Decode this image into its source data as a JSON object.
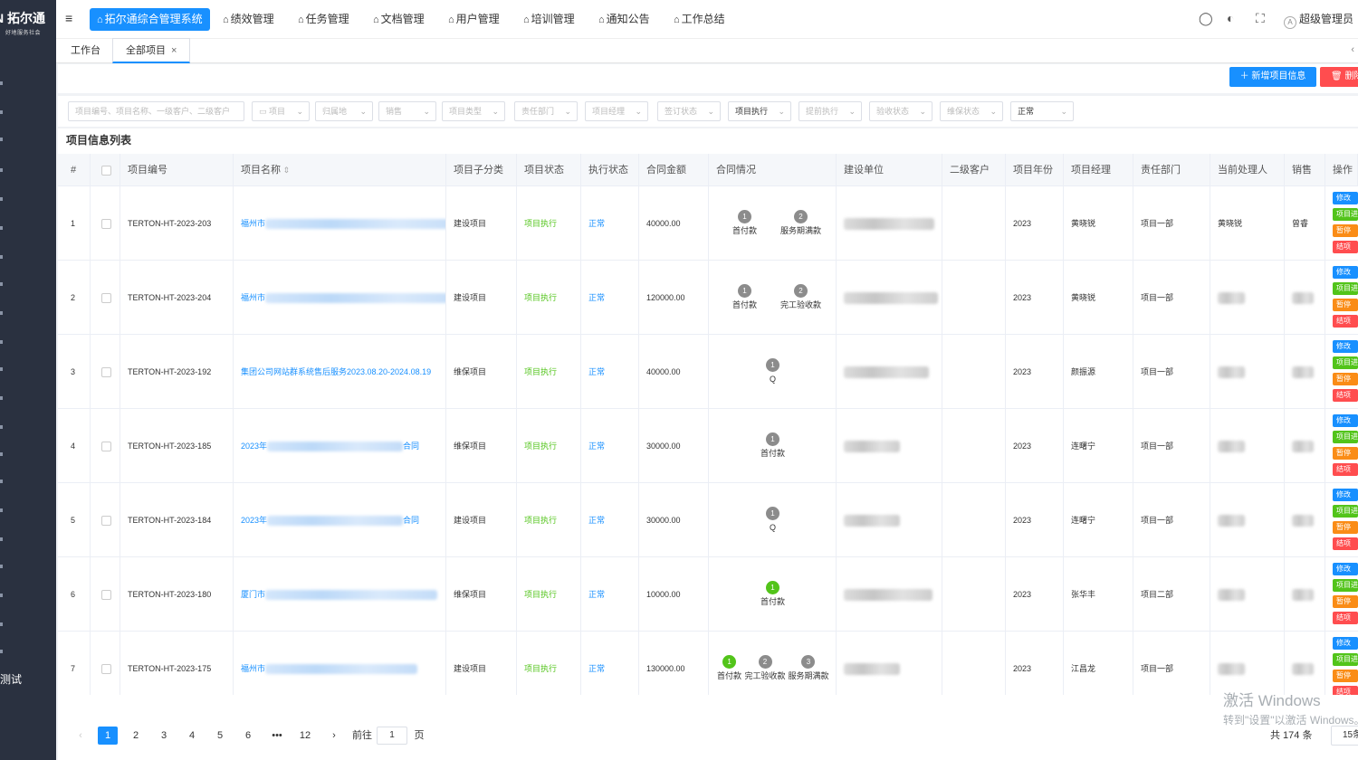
{
  "sidebar": {
    "logo_title": "N 拓尔通",
    "logo_sub": "好地服务社会",
    "bottom_item": "测试"
  },
  "header": {
    "menu_icon": "hamburger-icon",
    "nav": [
      {
        "label": "拓尔通综合管理系统",
        "active": true
      },
      {
        "label": "绩效管理"
      },
      {
        "label": "任务管理"
      },
      {
        "label": "文档管理"
      },
      {
        "label": "用户管理"
      },
      {
        "label": "培训管理"
      },
      {
        "label": "通知公告"
      },
      {
        "label": "工作总结"
      }
    ],
    "nav_icon": "home-icon",
    "icons": [
      "chat-icon",
      "palette-icon",
      "fullscreen-icon"
    ],
    "user": "超级管理员"
  },
  "tabs": [
    {
      "label": "工作台"
    },
    {
      "label": "全部项目",
      "active": true,
      "close": "×"
    }
  ],
  "toolbar": {
    "add_label": "＋ 新增项目信息",
    "delete_label": "删除"
  },
  "filters": [
    {
      "placeholder": "项目编号、项目名称、一级客户、二级客户"
    },
    {
      "placeholder": "项目"
    },
    {
      "placeholder": "归属地"
    },
    {
      "placeholder": "销售"
    },
    {
      "placeholder": "项目类型"
    },
    {
      "placeholder": "责任部门"
    },
    {
      "placeholder": "项目经理"
    },
    {
      "placeholder": "签订状态"
    },
    {
      "value": "项目执行"
    },
    {
      "placeholder": "提前执行"
    },
    {
      "placeholder": "验收状态"
    },
    {
      "placeholder": "维保状态"
    },
    {
      "value": "正常"
    }
  ],
  "list_title": "项目信息列表",
  "columns": [
    "#",
    "",
    "项目编号",
    "项目名称",
    "项目子分类",
    "项目状态",
    "执行状态",
    "合同金额",
    "合同情况",
    "建设单位",
    "二级客户",
    "项目年份",
    "项目经理",
    "责任部门",
    "当前处理人",
    "销售",
    "操作"
  ],
  "sort_icon": "sort-icon",
  "rows": [
    {
      "idx": "1",
      "code": "TERTON-HT-2023-203",
      "name_prefix": "福州市",
      "name_suffix": "",
      "sub": "建设项目",
      "status": "项目执行",
      "exec": "正常",
      "amount": "40000.00",
      "steps": [
        {
          "n": "1",
          "label": "首付款"
        },
        {
          "n": "2",
          "label": "服务期满款"
        }
      ],
      "year": "2023",
      "manager": "黄晓锐",
      "dept": "项目一部",
      "handler": "黄晓锐",
      "sales": "曾睿"
    },
    {
      "idx": "2",
      "code": "TERTON-HT-2023-204",
      "name_prefix": "福州市",
      "name_suffix": "",
      "sub": "建设项目",
      "status": "项目执行",
      "exec": "正常",
      "amount": "120000.00",
      "steps": [
        {
          "n": "1",
          "label": "首付款"
        },
        {
          "n": "2",
          "label": "完工验收款"
        }
      ],
      "year": "2023",
      "manager": "黄晓锐",
      "dept": "项目一部",
      "handler": "",
      "sales": ""
    },
    {
      "idx": "3",
      "code": "TERTON-HT-2023-192",
      "name_prefix": "集团公司网站群系统售后服务2023.08.20-2024.08.19",
      "name_suffix": "",
      "sub": "维保项目",
      "status": "项目执行",
      "exec": "正常",
      "amount": "40000.00",
      "steps": [
        {
          "n": "1",
          "label": "Q"
        }
      ],
      "year": "2023",
      "manager": "颜振源",
      "dept": "项目一部",
      "handler": "",
      "sales": ""
    },
    {
      "idx": "4",
      "code": "TERTON-HT-2023-185",
      "name_prefix": "2023年",
      "name_suffix": "合同",
      "sub": "维保项目",
      "status": "项目执行",
      "exec": "正常",
      "amount": "30000.00",
      "steps": [
        {
          "n": "1",
          "label": "首付款"
        }
      ],
      "year": "2023",
      "manager": "连曙宁",
      "dept": "项目一部",
      "handler": "",
      "sales": ""
    },
    {
      "idx": "5",
      "code": "TERTON-HT-2023-184",
      "name_prefix": "2023年",
      "name_suffix": "合同",
      "sub": "建设项目",
      "status": "项目执行",
      "exec": "正常",
      "amount": "30000.00",
      "steps": [
        {
          "n": "1",
          "label": "Q"
        }
      ],
      "year": "2023",
      "manager": "连曙宁",
      "dept": "项目一部",
      "handler": "",
      "sales": ""
    },
    {
      "idx": "6",
      "code": "TERTON-HT-2023-180",
      "name_prefix": "厦门市",
      "name_suffix": "",
      "sub": "维保项目",
      "status": "项目执行",
      "exec": "正常",
      "amount": "10000.00",
      "steps": [
        {
          "n": "1",
          "label": "首付款",
          "done": true
        }
      ],
      "year": "2023",
      "manager": "张华丰",
      "dept": "项目二部",
      "handler": "",
      "sales": ""
    },
    {
      "idx": "7",
      "code": "TERTON-HT-2023-175",
      "name_prefix": "福州市",
      "name_suffix": "",
      "sub": "建设项目",
      "status": "项目执行",
      "exec": "正常",
      "amount": "130000.00",
      "steps": [
        {
          "n": "1",
          "label": "首付款",
          "done": true
        },
        {
          "n": "2",
          "label": "完工验收款"
        },
        {
          "n": "3",
          "label": "服务期满款"
        }
      ],
      "year": "2023",
      "manager": "江昌龙",
      "dept": "项目一部",
      "handler": "",
      "sales": ""
    }
  ],
  "row_actions": [
    "修改",
    "项目进度",
    "暂停",
    "结项"
  ],
  "pager": {
    "prev": "‹",
    "next": "›",
    "pages": [
      "1",
      "2",
      "3",
      "4",
      "5",
      "6",
      "•••",
      "12"
    ],
    "current": "1",
    "goto_label": "前往",
    "goto_value": "1",
    "page_unit": "页",
    "total": "共 174 条",
    "page_size": "15条"
  },
  "watermark": {
    "line1": "激活 Windows",
    "line2": "转到\"设置\"以激活 Windows。"
  }
}
